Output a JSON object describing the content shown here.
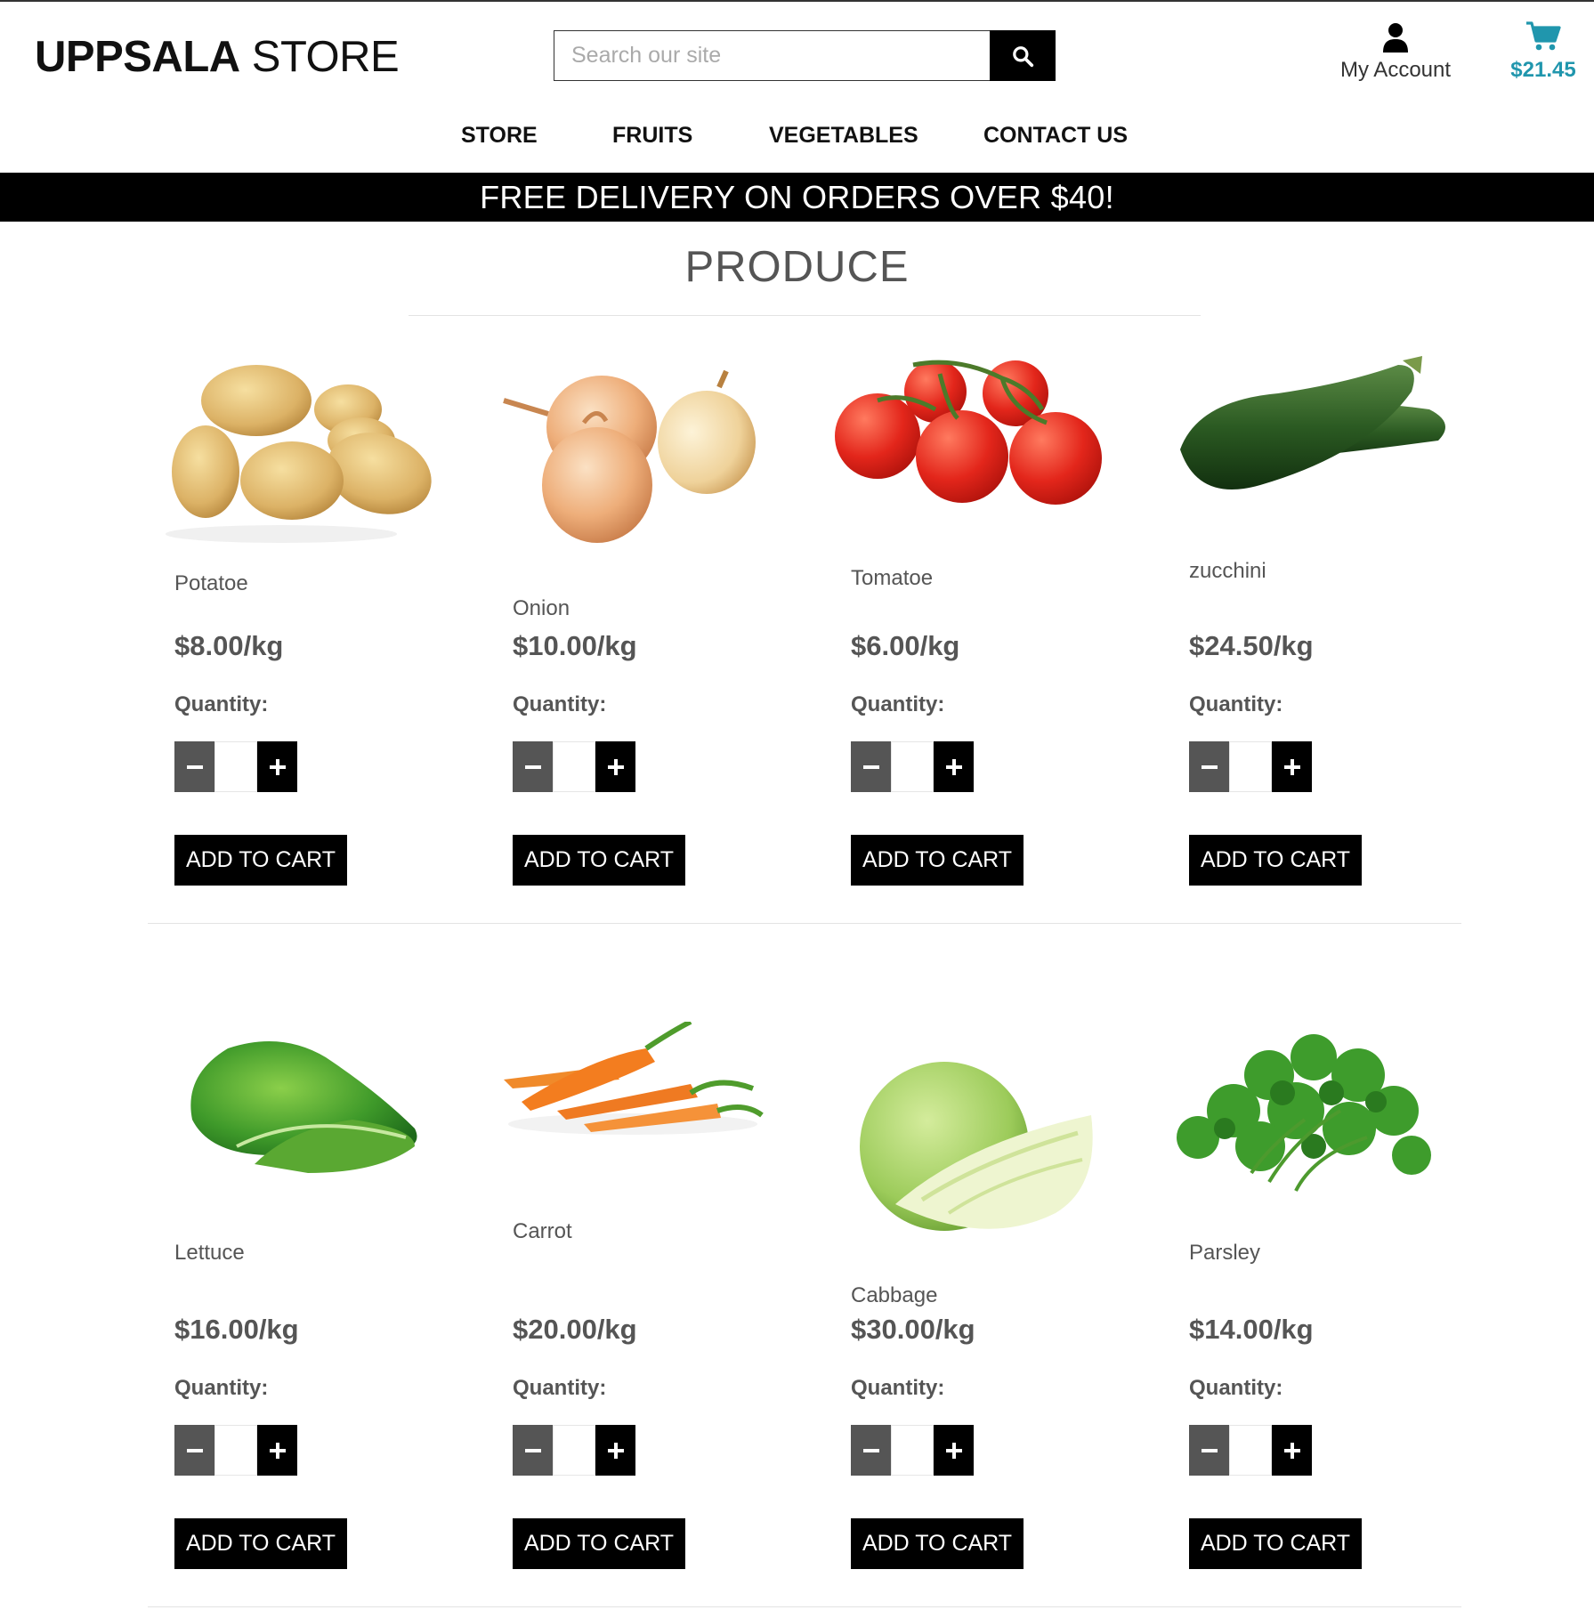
{
  "header": {
    "logo_bold": "UPPSALA",
    "logo_light": "STORE",
    "search_placeholder": "Search our site",
    "account_label": "My Account",
    "cart_total": "$21.45",
    "accent_color": "#2096ad"
  },
  "nav": [
    "STORE",
    "FRUITS",
    "VEGETABLES",
    "CONTACT US"
  ],
  "banner": "FREE DELIVERY ON ORDERS OVER $40!",
  "page_title": "PRODUCE",
  "quantity_label": "Quantity:",
  "add_to_cart_label": "ADD TO CART",
  "products": [
    {
      "name": "Potatoe",
      "price": "$8.00/kg",
      "image": "potato-image"
    },
    {
      "name": "Onion",
      "price": "$10.00/kg",
      "image": "onion-image"
    },
    {
      "name": "Tomatoe",
      "price": "$6.00/kg",
      "image": "tomato-image"
    },
    {
      "name": "zucchini",
      "price": "$24.50/kg",
      "image": "zucchini-image"
    },
    {
      "name": "Lettuce",
      "price": "$16.00/kg",
      "image": "lettuce-image"
    },
    {
      "name": "Carrot",
      "price": "$20.00/kg",
      "image": "carrot-image"
    },
    {
      "name": "Cabbage",
      "price": "$30.00/kg",
      "image": "cabbage-image"
    },
    {
      "name": "Parsley",
      "price": "$14.00/kg",
      "image": "parsley-image"
    }
  ],
  "icons": {
    "search": "search-icon",
    "account": "user-icon",
    "cart": "cart-icon",
    "minus": "minus-icon",
    "plus": "plus-icon"
  }
}
